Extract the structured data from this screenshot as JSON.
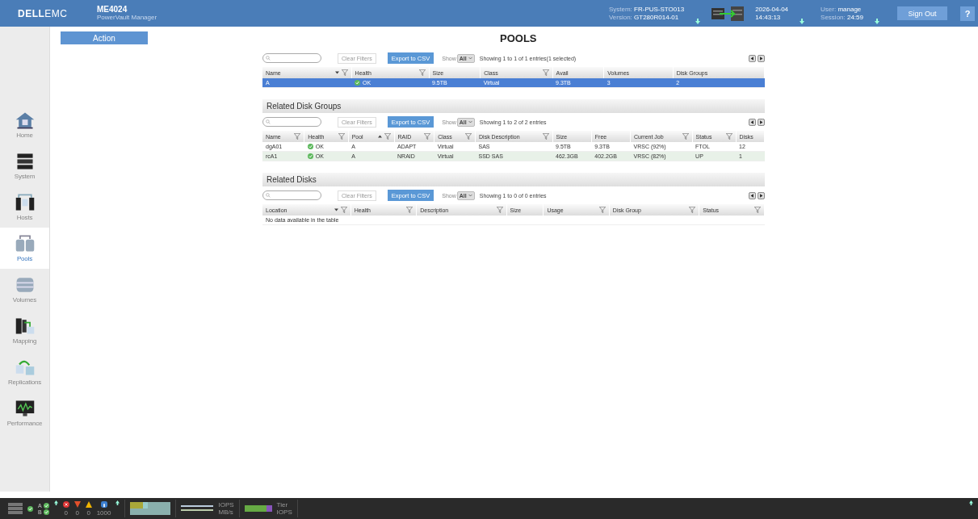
{
  "header": {
    "logo_bold": "DELL",
    "logo_light": "EMC",
    "product": "ME4024",
    "product_sub": "PowerVault Manager",
    "system_label": "System:",
    "system": "FR-PUS-STO013",
    "version_label": "Version:",
    "version": "GT280R014-01",
    "date": "2026-04-04",
    "time": "14:43:13",
    "user_label": "User:",
    "user": "manage",
    "session_label": "Session:",
    "session": "24:59",
    "sign_out": "Sign Out",
    "help": "?"
  },
  "sidebar": {
    "items": [
      {
        "label": "Home",
        "selected": false
      },
      {
        "label": "System",
        "selected": false
      },
      {
        "label": "Hosts",
        "selected": false
      },
      {
        "label": "Pools",
        "selected": true
      },
      {
        "label": "Volumes",
        "selected": false
      },
      {
        "label": "Mapping",
        "selected": false
      },
      {
        "label": "Replications",
        "selected": false
      },
      {
        "label": "Performance",
        "selected": false
      }
    ]
  },
  "action_button": "Action",
  "page_title": "POOLS",
  "sections": [
    {
      "clear_filters": "Clear Filters",
      "export": "Export to CSV",
      "show_label": "Show",
      "show_value": "All",
      "info": "Showing 1 to 1 of 1 entries(1 selected)",
      "columns": [
        {
          "label": "Name",
          "sorted": true,
          "ascending": false,
          "filter": true
        },
        {
          "label": "Health",
          "sorted": false,
          "filter": true,
          "kind": "health"
        },
        {
          "label": "Size",
          "sorted": false,
          "filter": false
        },
        {
          "label": "Class",
          "sorted": false,
          "filter": true
        },
        {
          "label": "Avail",
          "sorted": false,
          "filter": false
        },
        {
          "label": "Volumes",
          "sorted": false,
          "filter": false
        },
        {
          "label": "Disk Groups",
          "sorted": false,
          "filter": false
        }
      ],
      "rows": [
        {
          "selected": true,
          "cells": [
            "A",
            "OK",
            "9.5TB",
            "Virtual",
            "9.3TB",
            "3",
            "2"
          ]
        }
      ]
    },
    {
      "title": "Related Disk Groups",
      "clear_filters": "Clear Filters",
      "export": "Export to CSV",
      "show_label": "Show",
      "show_value": "All",
      "info": "Showing 1 to 2 of 2 entries",
      "columns": [
        {
          "label": "Name",
          "sorted": false,
          "filter": true
        },
        {
          "label": "Health",
          "sorted": false,
          "filter": true,
          "kind": "health"
        },
        {
          "label": "Pool",
          "sorted": true,
          "ascending": true,
          "filter": true
        },
        {
          "label": "RAID",
          "sorted": false,
          "filter": true
        },
        {
          "label": "Class",
          "sorted": false,
          "filter": true
        },
        {
          "label": "Disk Description",
          "sorted": false,
          "filter": true
        },
        {
          "label": "Size",
          "sorted": false,
          "filter": false
        },
        {
          "label": "Free",
          "sorted": false,
          "filter": false
        },
        {
          "label": "Current Job",
          "sorted": false,
          "filter": true
        },
        {
          "label": "Status",
          "sorted": false,
          "filter": true
        },
        {
          "label": "Disks",
          "sorted": false,
          "filter": false
        }
      ],
      "rows": [
        {
          "selected": false,
          "cells": [
            "dgA01",
            "OK",
            "A",
            "ADAPT",
            "Virtual",
            "SAS",
            "9.5TB",
            "9.3TB",
            "VRSC (92%)",
            "FTOL",
            "12"
          ]
        },
        {
          "selected": false,
          "cells": [
            "rcA1",
            "OK",
            "A",
            "NRAID",
            "Virtual",
            "SSD SAS",
            "462.3GB",
            "402.2GB",
            "VRSC (82%)",
            "UP",
            "1"
          ]
        }
      ]
    },
    {
      "title": "Related Disks",
      "clear_filters": "Clear Filters",
      "export": "Export to CSV",
      "show_label": "Show",
      "show_value": "All",
      "info": "Showing 1 to 0 of 0 entries",
      "columns": [
        {
          "label": "Location",
          "sorted": true,
          "ascending": false,
          "filter": true
        },
        {
          "label": "Health",
          "sorted": false,
          "filter": true
        },
        {
          "label": "Description",
          "sorted": false,
          "filter": true
        },
        {
          "label": "Size",
          "sorted": false,
          "filter": false
        },
        {
          "label": "Usage",
          "sorted": false,
          "filter": true
        },
        {
          "label": "Disk Group",
          "sorted": false,
          "filter": true
        },
        {
          "label": "Status",
          "sorted": false,
          "filter": true
        }
      ],
      "empty": "No data available in the table"
    }
  ],
  "footer": {
    "controller_a": "A",
    "controller_b": "B",
    "errors": "0",
    "criticals": "0",
    "warnings": "0",
    "infos": "1000",
    "iops": "IOPS",
    "mbs": "MB/s",
    "tier": "Tier",
    "tier_iops": "IOPS"
  }
}
